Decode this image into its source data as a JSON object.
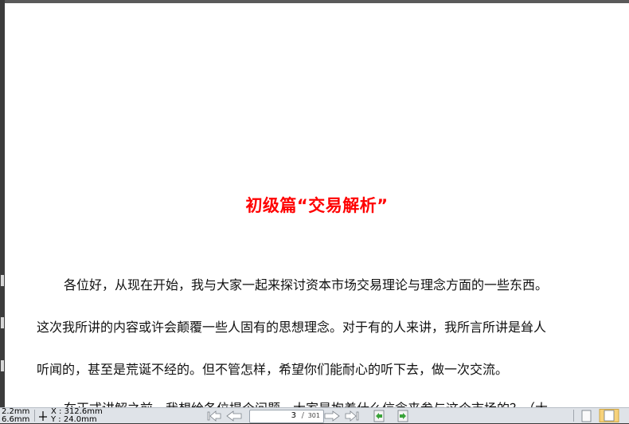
{
  "document": {
    "title": "初级篇“交易解析”",
    "lines": [
      "各位好，从现在开始，我与大家一起来探讨资本市场交易理论与理念方面的一些东西。",
      "这次我所讲的内容或许会颠覆一些人固有的思想理念。对于有的人来讲，我所言所讲是耸人",
      "听闻的，甚至是荒诞不经的。但不管怎样，希望你们能耐心的听下去，做一次交流。",
      "在正式讲解之前，我想给各位提个问题，大家是抱着什么信念来参与这个市场的？（大"
    ]
  },
  "statusbar": {
    "size_w": "2.2mm",
    "size_h": "6.6mm",
    "x_label": "X : 312.6mm",
    "y_label": "Y :   24.0mm",
    "current_page": "3",
    "slash": "/",
    "total_pages": "301"
  },
  "colors": {
    "title": "#ff0000",
    "page": "#ffffff",
    "statusbar": "#dfe3e8"
  }
}
